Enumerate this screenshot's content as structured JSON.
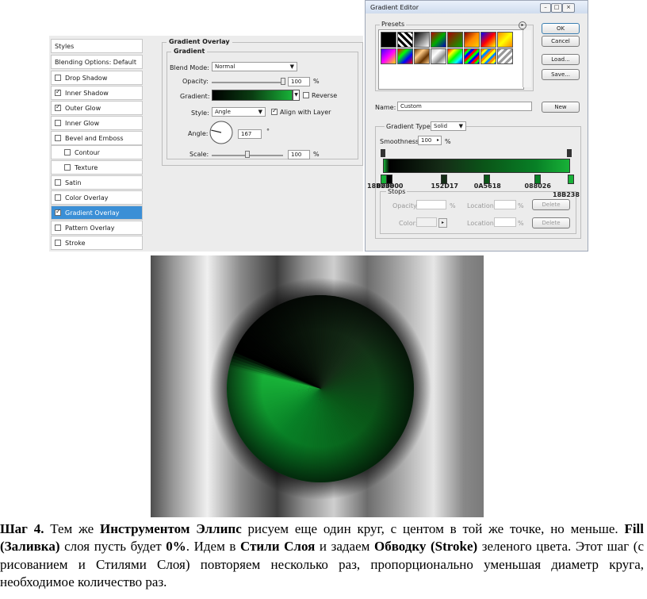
{
  "layer_style": {
    "styles_list": [
      {
        "label": "Styles",
        "type": "header"
      },
      {
        "label": "Blending Options: Default",
        "type": "header"
      },
      {
        "label": "Drop Shadow",
        "checked": false
      },
      {
        "label": "Inner Shadow",
        "checked": true
      },
      {
        "label": "Outer Glow",
        "checked": true
      },
      {
        "label": "Inner Glow",
        "checked": false
      },
      {
        "label": "Bevel and Emboss",
        "checked": false
      },
      {
        "label": "Contour",
        "checked": false,
        "indent": true
      },
      {
        "label": "Texture",
        "checked": false,
        "indent": true
      },
      {
        "label": "Satin",
        "checked": false
      },
      {
        "label": "Color Overlay",
        "checked": false
      },
      {
        "label": "Gradient Overlay",
        "checked": true,
        "selected": true
      },
      {
        "label": "Pattern Overlay",
        "checked": false
      },
      {
        "label": "Stroke",
        "checked": false
      }
    ],
    "panel_title": "Gradient Overlay",
    "group_title": "Gradient",
    "blend_mode_label": "Blend Mode:",
    "blend_mode_value": "Normal",
    "opacity_label": "Opacity:",
    "opacity_value": "100",
    "opacity_unit": "%",
    "opacity_level": 1.0,
    "gradient_label": "Gradient:",
    "reverse_label": "Reverse",
    "style_label": "Style:",
    "style_value": "Angle",
    "align_label": "Align with Layer",
    "angle_label": "Angle:",
    "angle_value": "167",
    "angle_unit": "°",
    "scale_label": "Scale:",
    "scale_value": "100",
    "scale_unit": "%",
    "scale_level": 0.5
  },
  "gradient_editor": {
    "title": "Gradient Editor",
    "presets_label": "Presets",
    "ok_label": "OK",
    "cancel_label": "Cancel",
    "load_label": "Load...",
    "save_label": "Save...",
    "name_label": "Name:",
    "name_value": "Custom",
    "new_label": "New",
    "gradient_type_label": "Gradient Type:",
    "gradient_type_value": "Solid",
    "smoothness_label": "Smoothness:",
    "smoothness_value": "100",
    "smoothness_unit": "%",
    "stops_label": "Stops",
    "opacity_label": "Opacity:",
    "color_label": "Color:",
    "location_label": "Location:",
    "pct": "%",
    "delete_label": "Delete",
    "color_stops": [
      {
        "label": "18B238",
        "color": "#18B238",
        "location": 0.0
      },
      {
        "label": "000000",
        "color": "#000000",
        "location": 0.03
      },
      {
        "label": "152D17",
        "color": "#152D17",
        "location": 0.32
      },
      {
        "label": "0A5618",
        "color": "#0A5618",
        "location": 0.55
      },
      {
        "label": "088026",
        "color": "#088026",
        "location": 0.82
      },
      {
        "label": "18B238",
        "color": "#18B238",
        "location": 1.0
      }
    ]
  },
  "paragraph": {
    "p1": "Шаг 4.",
    "p2": " Тем же ",
    "p3": "Инструментом Эллипс",
    "p4": " рисуем еще один круг, с центом в той же точке, но меньше. ",
    "p5": "Fill (Заливка)",
    "p6": " слоя пусть будет ",
    "p7": "0%",
    "p8": ". Идем в ",
    "p9": "Стили Слоя",
    "p10": " и задаем ",
    "p11": "Обводку (Stroke)",
    "p12": " зеленого цвета. Этот шаг (с рисованием и Стилями Слоя) повторяем несколько раз, пропорционально уменьшая диаметр круга, необходимое количество раз."
  }
}
